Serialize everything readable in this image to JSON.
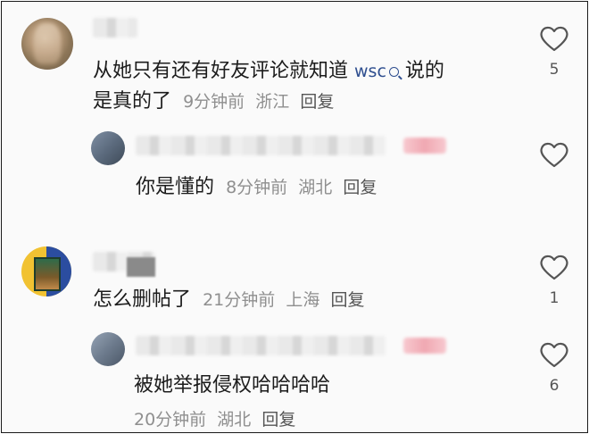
{
  "comments": [
    {
      "text_line1": "从她只有还有好友评论就知道",
      "keyword": "wsc",
      "text_line1_tail": "说的",
      "text_line2": "是真的了",
      "time": "9分钟前",
      "location": "浙江",
      "reply_label": "回复",
      "likes": "5"
    },
    {
      "text": "你是懂的",
      "time": "8分钟前",
      "location": "湖北",
      "reply_label": "回复"
    },
    {
      "text": "怎么删帖了",
      "time": "21分钟前",
      "location": "上海",
      "reply_label": "回复",
      "likes": "1"
    },
    {
      "text": "被她举报侵权哈哈哈哈",
      "time": "20分钟前",
      "location": "湖北",
      "reply_label": "回复",
      "likes": "6"
    }
  ],
  "colors": {
    "accent_link": "#2e4e8f",
    "meta_gray": "#8f8f8f",
    "tag_pink": "#f0a8b2"
  },
  "icons": [
    "heart-outline-icon",
    "search-icon"
  ]
}
